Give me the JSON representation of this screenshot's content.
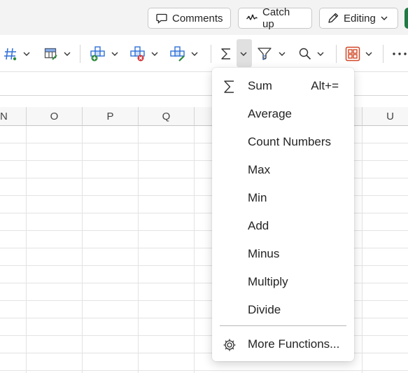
{
  "header": {
    "comments_label": "Comments",
    "catchup_label": "Catch up",
    "editing_label": "Editing"
  },
  "sheet": {
    "columns": [
      "N",
      "O",
      "P",
      "Q",
      "U"
    ]
  },
  "autosum_menu": {
    "items": [
      {
        "label": "Sum",
        "shortcut": "Alt+="
      },
      {
        "label": "Average"
      },
      {
        "label": "Count Numbers"
      },
      {
        "label": "Max"
      },
      {
        "label": "Min"
      },
      {
        "label": "Add"
      },
      {
        "label": "Minus"
      },
      {
        "label": "Multiply"
      },
      {
        "label": "Divide"
      }
    ],
    "more_label": "More Functions..."
  },
  "colors": {
    "accent_green": "#1f7a43",
    "insert_plus_green": "#2e8b3e",
    "delete_red": "#d13438",
    "icon_blue": "#2f6fd6",
    "conditional_orange": "#d24726"
  },
  "icons": [
    "comment-icon",
    "catchup-icon",
    "pencil-icon",
    "number-format-icon",
    "table-format-icon",
    "insert-cells-icon",
    "delete-cells-icon",
    "format-cells-icon",
    "sigma-icon",
    "sort-filter-icon",
    "find-icon",
    "addins-icon",
    "more-icon",
    "gear-icon"
  ]
}
